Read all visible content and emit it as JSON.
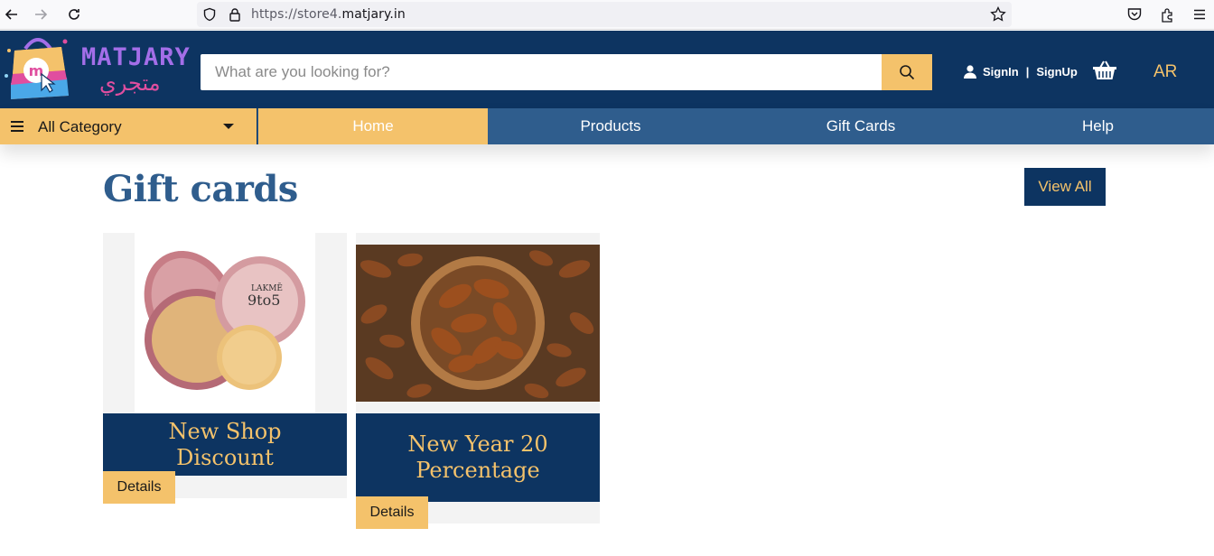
{
  "browser": {
    "url_prefix": "https://store4.",
    "url_domain": "matjary.in",
    "icons": [
      "back-icon",
      "forward-icon",
      "reload-icon",
      "shield-icon",
      "lock-icon",
      "star-icon",
      "pocket-icon",
      "extensions-icon",
      "menu-icon"
    ]
  },
  "header": {
    "logo_text": "MATJARY",
    "logo_arabic": "متجري",
    "search_placeholder": "What are you looking for?",
    "signin_label": "SignIn",
    "separator": "|",
    "signup_label": "SignUp",
    "language_label": "AR"
  },
  "nav": {
    "all_category_label": "All Category",
    "items": [
      {
        "label": "Home"
      },
      {
        "label": "Products"
      },
      {
        "label": "Gift Cards"
      },
      {
        "label": "Help"
      }
    ]
  },
  "main": {
    "section_title": "Gift cards",
    "view_all_label": "View All",
    "cards": [
      {
        "title": "New Shop Discount",
        "details_label": "Details"
      },
      {
        "title": "New Year 20 Percentage",
        "details_label": "Details"
      }
    ]
  },
  "colors": {
    "header_navy": "#0d3461",
    "nav_blue": "#2f5d8d",
    "accent_yellow": "#f4c26b"
  }
}
